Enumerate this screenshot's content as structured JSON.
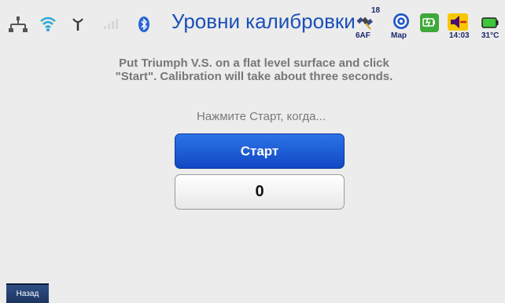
{
  "status_bar": {
    "title": "Уровни калибровки",
    "satellite_count": "18",
    "satellite_label": "6AF",
    "map_label": "Map",
    "time": "14:03",
    "temperature": "31°C",
    "icons": [
      "network-icon",
      "wifi-icon",
      "antenna-icon",
      "signal-icon",
      "bluetooth-icon",
      "satellite-icon",
      "map-icon",
      "battery-charge-icon",
      "volume-icon",
      "battery-icon"
    ]
  },
  "main": {
    "instruction_line1": "Put Triumph V.S. on a flat level surface and click",
    "instruction_line2": "\"Start\". Calibration will take about three seconds.",
    "prompt": "Нажмите Старт, когда...",
    "start_label": "Старт",
    "counter_value": "0"
  },
  "footer": {
    "back_label": "Назад"
  },
  "colors": {
    "accent": "#1a4fb8",
    "start_button": "#1149c4",
    "background": "#ececec"
  }
}
